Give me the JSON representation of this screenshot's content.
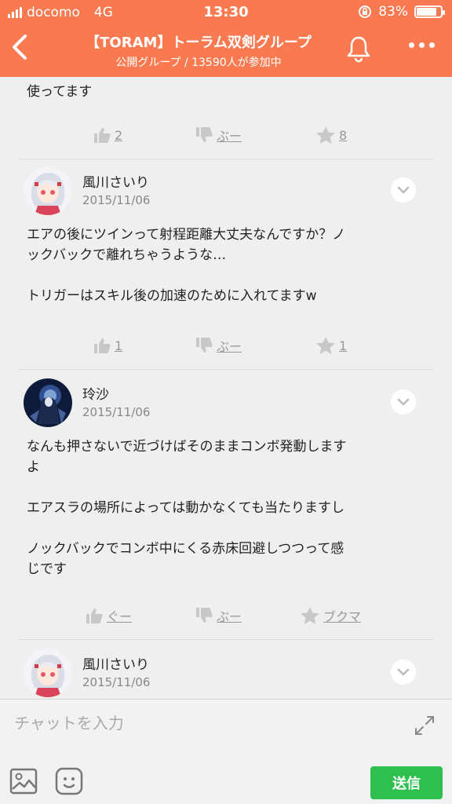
{
  "status_bar": {
    "carrier": "docomo",
    "network": "4G",
    "time": "13:30",
    "battery": "83%",
    "battery_level": 0.83
  },
  "header": {
    "title": "【TORAM】トーラム双剣グループ",
    "subtitle": "公開グループ / 13590人が参加中"
  },
  "posts": [
    {
      "fragment_text": "使ってます",
      "actions": {
        "like": "2",
        "dislike": "ぶー",
        "bookmark": "8"
      }
    },
    {
      "user": "風川さいり",
      "date": "2015/11/06",
      "text": [
        "エアの後にツインって射程距離大丈夫なんですか？ノ",
        "ックバックで離れちゃうような…",
        "",
        "トリガーはスキル後の加速のために入れてますw"
      ],
      "actions": {
        "like": "1",
        "dislike": "ぶー",
        "bookmark": "1"
      }
    },
    {
      "user": "玲沙",
      "date": "2015/11/06",
      "text": [
        "なんも押さないで近づけばそのままコンボ発動します",
        "よ",
        "",
        "エアスラの場所によっては動かなくても当たりますし",
        "",
        "ノックバックでコンボ中にくる赤床回避しつつって感",
        "じです"
      ],
      "actions": {
        "like": "ぐー",
        "dislike": "ぶー",
        "bookmark": "ブクマ"
      }
    },
    {
      "user": "風川さいり",
      "date": "2015/11/06"
    }
  ],
  "input": {
    "placeholder": "チャットを入力",
    "send_label": "送信"
  },
  "colors": {
    "header": "#f97a50",
    "send": "#2fbf4f",
    "icon_gray": "#aaaaaa"
  },
  "icons": [
    "back-arrow-icon",
    "bell-icon",
    "more-icon",
    "thumbs-up-icon",
    "thumbs-down-icon",
    "star-icon",
    "chevron-down-icon",
    "expand-icon",
    "image-icon",
    "emoji-icon"
  ]
}
